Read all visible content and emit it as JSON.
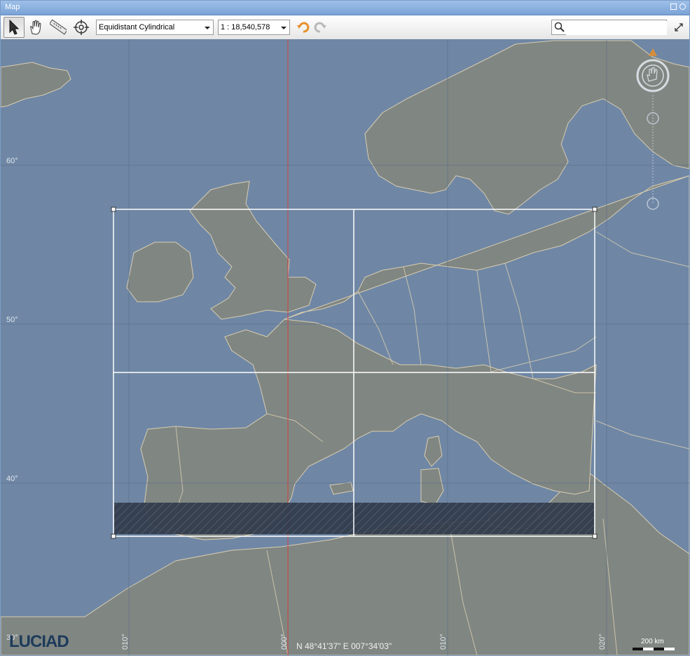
{
  "window": {
    "title": "Map"
  },
  "toolbar": {
    "projection": "Equidistant Cylindrical",
    "scale": "1 : 18,540,578",
    "search_placeholder": ""
  },
  "map": {
    "lat_labels": [
      "60°",
      "50°",
      "40°",
      "30°"
    ],
    "lon_labels": [
      "010°",
      "000°",
      "010°",
      "020°"
    ],
    "coordinates": "N 48°41'37\" E 007°34'03\"",
    "scale_bar": "200 km",
    "logo": "LUCIAD"
  },
  "colors": {
    "sea": "#6f87a5",
    "land": "#808682",
    "border": "#d9cdb0",
    "accent": "#e8902a"
  }
}
